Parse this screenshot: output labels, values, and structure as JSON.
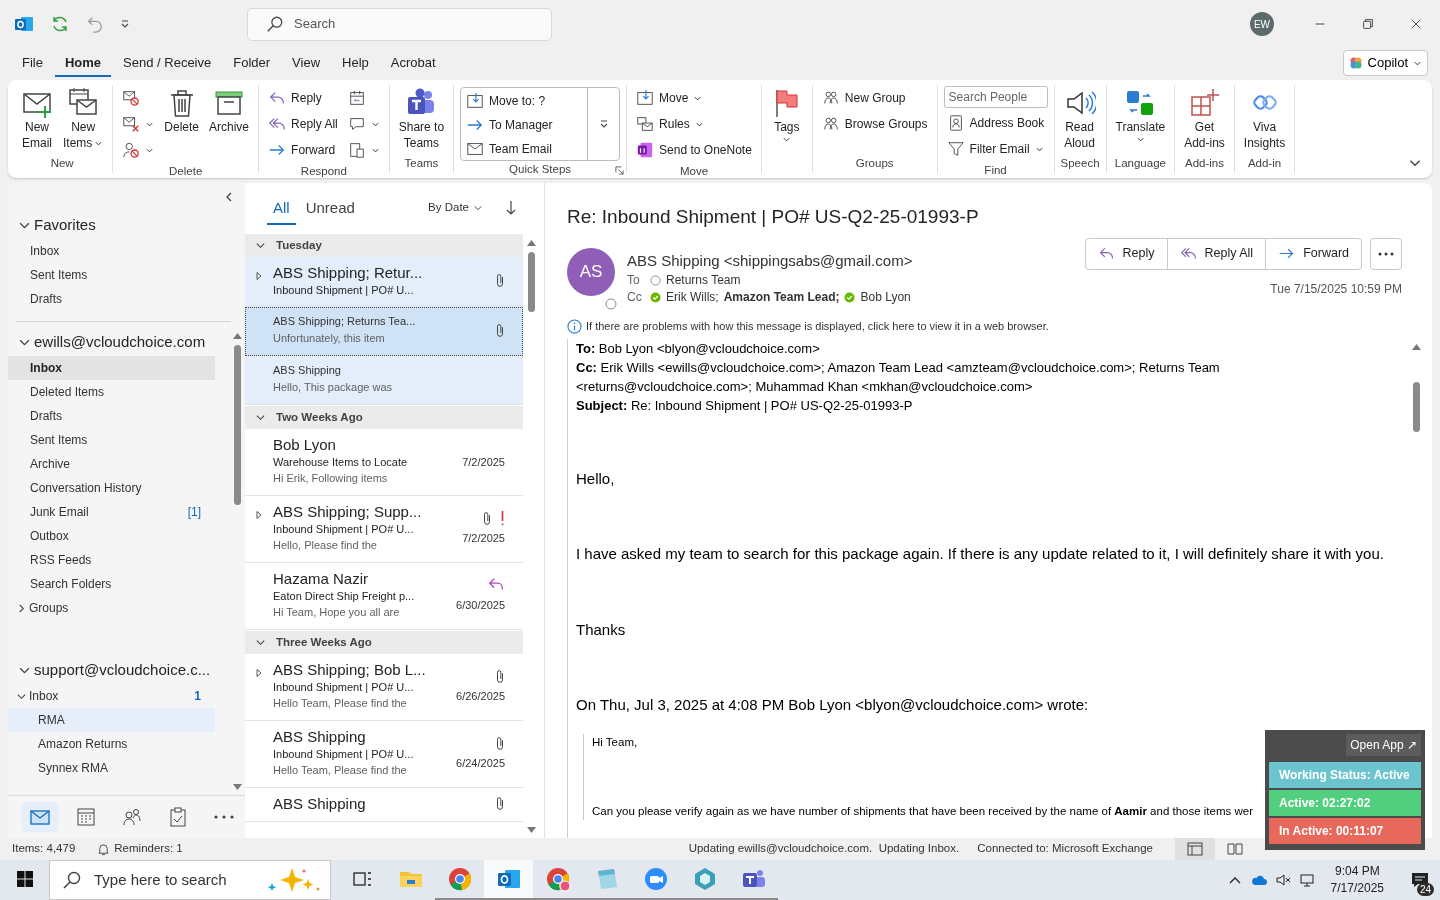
{
  "title_bar": {
    "search_placeholder": "Search",
    "avatar": "EW"
  },
  "menu_tabs": [
    {
      "label": "File",
      "selected": false
    },
    {
      "label": "Home",
      "selected": true
    },
    {
      "label": "Send / Receive",
      "selected": false
    },
    {
      "label": "Folder",
      "selected": false
    },
    {
      "label": "View",
      "selected": false
    },
    {
      "label": "Help",
      "selected": false
    },
    {
      "label": "Acrobat",
      "selected": false
    }
  ],
  "copilot": "Copilot",
  "ribbon": {
    "groups": [
      {
        "label": "New",
        "columns": [
          [
            {
              "kind": "large",
              "lines": [
                "New",
                "Email"
              ],
              "dropdown": false
            }
          ],
          [
            {
              "kind": "large",
              "lines": [
                "New",
                "Items"
              ],
              "dropdown": true
            }
          ]
        ]
      },
      {
        "label": "Delete",
        "columns": [
          [
            {
              "kind": "icon",
              "dropdown": false
            },
            {
              "kind": "icon",
              "dropdown": true
            },
            {
              "kind": "icon",
              "dropdown": true
            }
          ],
          [
            {
              "kind": "large",
              "lines": [
                "Delete"
              ],
              "dropdown": false
            }
          ],
          [
            {
              "kind": "large",
              "lines": [
                "Archive"
              ],
              "dropdown": false
            }
          ]
        ]
      },
      {
        "label": "Respond",
        "columns": [
          [
            {
              "kind": "small",
              "label": "Reply",
              "dropdown": false
            },
            {
              "kind": "small",
              "label": "Reply All",
              "dropdown": false
            },
            {
              "kind": "small",
              "label": "Forward",
              "dropdown": false
            }
          ],
          [
            {
              "kind": "icon",
              "dropdown": false
            },
            {
              "kind": "icon",
              "dropdown": true
            },
            {
              "kind": "icon",
              "dropdown": true
            }
          ]
        ]
      },
      {
        "label": "Teams",
        "columns": [
          [
            {
              "kind": "large",
              "lines": [
                "Share to",
                "Teams"
              ],
              "dropdown": false
            }
          ]
        ]
      },
      {
        "label": "Quick Steps",
        "launcher": true,
        "columns": [
          [
            {
              "kind": "gallery",
              "entries": [
                "Move to: ?",
                "To Manager",
                "Team Email"
              ]
            }
          ]
        ]
      },
      {
        "label": "Move",
        "columns": [
          [
            {
              "kind": "small",
              "label": "Move",
              "dropdown": true
            },
            {
              "kind": "small",
              "label": "Rules",
              "dropdown": true
            },
            {
              "kind": "small",
              "label": "Send to OneNote",
              "dropdown": false
            }
          ]
        ]
      },
      {
        "columns": [
          [
            {
              "kind": "large",
              "lines": [
                "Tags"
              ],
              "dropdown": true
            }
          ]
        ]
      },
      {
        "label": "Groups",
        "columns": [
          [
            {
              "kind": "small",
              "label": "New Group",
              "dropdown": false
            },
            {
              "kind": "small",
              "label": "Browse Groups",
              "dropdown": false
            }
          ]
        ]
      },
      {
        "label": "Find",
        "columns": [
          [
            {
              "kind": "search",
              "placeholder": "Search People"
            },
            {
              "kind": "small",
              "label": "Address Book",
              "dropdown": false
            },
            {
              "kind": "small",
              "label": "Filter Email",
              "dropdown": true
            }
          ]
        ]
      },
      {
        "label": "Speech",
        "columns": [
          [
            {
              "kind": "large",
              "lines": [
                "Read",
                "Aloud"
              ],
              "dropdown": false
            }
          ]
        ]
      },
      {
        "label": "Language",
        "columns": [
          [
            {
              "kind": "large",
              "lines": [
                "Translate"
              ],
              "dropdown": true
            }
          ]
        ]
      },
      {
        "label": "Add-ins",
        "columns": [
          [
            {
              "kind": "large",
              "lines": [
                "Get",
                "Add-ins"
              ],
              "dropdown": false
            }
          ]
        ]
      },
      {
        "label": "Add-in",
        "columns": [
          [
            {
              "kind": "large",
              "lines": [
                "Viva",
                "Insights"
              ],
              "dropdown": false
            }
          ]
        ]
      }
    ]
  },
  "folder_pane": {
    "favorites": {
      "title": "Favorites",
      "expanded": true,
      "folders": [
        {
          "name": "Inbox",
          "selected": false,
          "hovered": false
        },
        {
          "name": "Sent Items",
          "selected": false,
          "hovered": false
        },
        {
          "name": "Drafts",
          "selected": false,
          "hovered": false
        }
      ]
    },
    "accounts": [
      {
        "title": "ewills@vcloudchoice.com",
        "expanded": true,
        "folders": [
          {
            "name": "Inbox",
            "selected": true,
            "hovered": false
          },
          {
            "name": "Deleted Items",
            "selected": false,
            "hovered": false
          },
          {
            "name": "Drafts",
            "selected": false,
            "hovered": false
          },
          {
            "name": "Sent Items",
            "selected": false,
            "hovered": false
          },
          {
            "name": "Archive",
            "selected": false,
            "hovered": false
          },
          {
            "name": "Conversation History",
            "selected": false,
            "hovered": false
          },
          {
            "name": "Junk Email",
            "count": "[1]",
            "selected": false,
            "hovered": false
          },
          {
            "name": "Outbox",
            "selected": false,
            "hovered": false
          },
          {
            "name": "RSS Feeds",
            "selected": false,
            "hovered": false
          },
          {
            "name": "Search Folders",
            "selected": false,
            "hovered": false
          },
          {
            "name": "Groups",
            "expanded": false,
            "selected": false,
            "hovered": false
          }
        ]
      },
      {
        "title": "support@vcloudchoice.c...",
        "expanded": true,
        "folders": [
          {
            "name": "Inbox",
            "count": "1",
            "expanded": true,
            "selected": false,
            "hovered": false,
            "children": [
              {
                "name": "RMA",
                "selected": false,
                "hovered": true
              },
              {
                "name": "Amazon Returns",
                "selected": false,
                "hovered": false
              },
              {
                "name": "Synnex RMA",
                "selected": false,
                "hovered": false
              }
            ]
          }
        ]
      }
    ],
    "nav": [
      {
        "selected": true
      },
      {
        "selected": false
      },
      {
        "selected": false
      },
      {
        "selected": false
      },
      {
        "selected": false
      }
    ]
  },
  "message_list": {
    "tabs": [
      {
        "label": "All",
        "selected": true
      },
      {
        "label": "Unread",
        "selected": false
      }
    ],
    "sort": "By Date",
    "groups": [
      {
        "label": "Tuesday",
        "expanded": true,
        "items": [
          {
            "kind": "thread",
            "sender": "ABS Shipping;  Retur...",
            "subject": "Inbound Shipment | PO# U...",
            "attachment": true,
            "important": false,
            "replied": false,
            "highlighted": true,
            "selected": false
          },
          {
            "kind": "child",
            "sender": "ABS Shipping;  Returns Tea...",
            "preview": "Unfortunately, this item",
            "attachment": true,
            "important": false,
            "replied": false,
            "highlighted": true,
            "selected": true
          },
          {
            "kind": "child",
            "sender": "ABS Shipping",
            "preview": "Hello,  This package was",
            "attachment": false,
            "important": false,
            "replied": false,
            "highlighted": true,
            "selected": false
          }
        ]
      },
      {
        "label": "Two Weeks Ago",
        "expanded": true,
        "items": [
          {
            "kind": "message",
            "sender": "Bob Lyon",
            "subject": "Warehouse Items to Locate",
            "preview": "Hi Erik,  Following items",
            "date": "7/2/2025",
            "attachment": false,
            "important": false,
            "replied": false,
            "highlighted": false,
            "selected": false
          },
          {
            "kind": "thread",
            "sender": "ABS Shipping;  Supp...",
            "subject": "Inbound Shipment | PO# U...",
            "preview": "Hello,  Please find the",
            "date": "7/2/2025",
            "attachment": true,
            "important": true,
            "replied": false,
            "highlighted": false,
            "selected": false
          },
          {
            "kind": "message",
            "sender": "Hazama Nazir",
            "subject": "Eaton Direct Ship Freight p...",
            "preview": "Hi Team,  Hope you all are",
            "date": "6/30/2025",
            "attachment": false,
            "important": false,
            "replied": true,
            "highlighted": false,
            "selected": false
          }
        ]
      },
      {
        "label": "Three Weeks Ago",
        "expanded": true,
        "items": [
          {
            "kind": "thread",
            "sender": "ABS Shipping;  Bob L...",
            "subject": "Inbound Shipment | PO# U...",
            "preview": "Hello Team,  Please find the",
            "date": "6/26/2025",
            "attachment": true,
            "important": false,
            "replied": false,
            "highlighted": false,
            "selected": false
          },
          {
            "kind": "message",
            "sender": "ABS Shipping",
            "subject": "Inbound Shipment | PO# U...",
            "preview": "Hello Team,  Please find the",
            "date": "6/24/2025",
            "attachment": true,
            "important": false,
            "replied": false,
            "highlighted": false,
            "selected": false
          },
          {
            "kind": "message",
            "sender": "ABS Shipping",
            "attachment": true,
            "important": false,
            "replied": false,
            "highlighted": false,
            "selected": false
          }
        ]
      }
    ]
  },
  "reading_pane": {
    "subject": "Re: Inbound Shipment | PO# US-Q2-25-01993-P",
    "sender_initials": "AS",
    "sender": "ABS Shipping <shippingsabs@gmail.com>",
    "to_label": "To",
    "to": [
      {
        "name": "Returns Team",
        "available": false,
        "group": false
      }
    ],
    "cc_label": "Cc",
    "cc": [
      {
        "name": "Erik Wills;",
        "available": true,
        "group": false
      },
      {
        "name": "Amazon Team Lead;",
        "group": true
      },
      {
        "name": "Bob Lyon",
        "available": true,
        "group": false
      }
    ],
    "actions": [
      "Reply",
      "Reply All",
      "Forward"
    ],
    "date": "Tue 7/15/2025 10:59 PM",
    "info": "If there are problems with how this message is displayed, click here to view it in a web browser.",
    "body": [
      {
        "kind": "meta",
        "segments": [
          {
            "text": "**To:** Bob Lyon <"
          },
          {
            "link": "blyon@vcloudchoice.com"
          },
          {
            "text": ">"
          }
        ]
      },
      {
        "kind": "meta",
        "segments": [
          {
            "text": "**Cc:** Erik Wills <"
          },
          {
            "link": "ewills@vcloudchoice.com"
          },
          {
            "text": ">; Amazon Team Lead <"
          },
          {
            "link": "amzteam@vcloudchoice.com"
          },
          {
            "text": ">; Returns Team <"
          },
          {
            "link": "returns@vcloudchoice.com"
          },
          {
            "text": ">; Muhammad Khan <"
          },
          {
            "link": "mkhan@vcloudchoice.com"
          },
          {
            "text": ">"
          }
        ]
      },
      {
        "kind": "meta",
        "segments": [
          {
            "text": "**Subject:** Re: Inbound Shipment | PO# US-Q2-25-01993-P"
          }
        ]
      },
      {
        "kind": "text",
        "segments": [
          {
            "text": "Hello,"
          }
        ]
      },
      {
        "kind": "text",
        "segments": [
          {
            "text": "I have asked my team to search for this package again. If there is any update related to it, I will definitely share it with you."
          }
        ]
      },
      {
        "kind": "text",
        "segments": [
          {
            "text": "Thanks"
          }
        ]
      },
      {
        "kind": "text",
        "segments": [
          {
            "text": "On Thu, Jul 3, 2025 at 4:08 PM Bob Lyon <"
          },
          {
            "link": "blyon@vcloudchoice.com"
          },
          {
            "text": "> wrote:"
          }
        ]
      },
      {
        "kind": "quote",
        "segments": [
          {
            "text": "Hi Team,"
          }
        ]
      },
      {
        "kind": "quote",
        "segments": [
          {
            "text": "Can you please verify again as we have number of shipments that have been received by the name of **Aamir** and those items wer"
          }
        ]
      }
    ]
  },
  "tracker": {
    "open_app": "Open App ↗",
    "rows": [
      {
        "label": "Working Status: Active",
        "color": "#6cc4cf"
      },
      {
        "label": "Active: 02:27:02",
        "color": "#52cf7e"
      },
      {
        "label": "In Active: 00:11:07",
        "color": "#e8685c"
      }
    ]
  },
  "status_bar": {
    "items": "Items: 4,479",
    "reminders": "Reminders: 1",
    "sync": "Updating ewills@vcloudchoice.com.  Updating Inbox.",
    "connection": "Connected to: Microsoft Exchange",
    "views": [
      {
        "selected": true
      },
      {
        "selected": false
      }
    ]
  },
  "taskbar": {
    "search_placeholder": "Type here to search",
    "apps": [
      {
        "running": false,
        "selected": false
      },
      {
        "running": true,
        "selected": false
      },
      {
        "running": true,
        "selected": true
      },
      {
        "running": true,
        "selected": false
      },
      {
        "running": true,
        "selected": false
      },
      {
        "running": true,
        "selected": false
      },
      {
        "running": true,
        "selected": false
      },
      {
        "running": true,
        "selected": false
      }
    ],
    "time": "9:04 PM",
    "date": "7/17/2025",
    "notifications": "24"
  }
}
